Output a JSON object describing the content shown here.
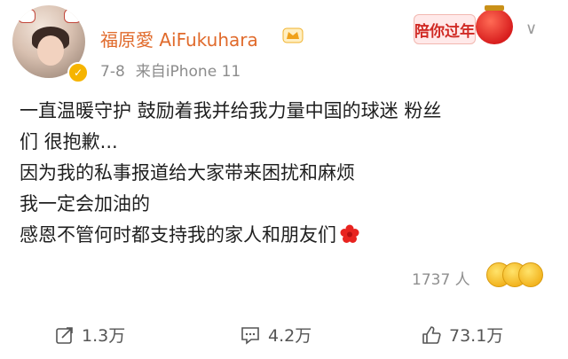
{
  "header": {
    "username": "福原愛 AiFukuhara",
    "date": "7-8",
    "source": "来自iPhone 11",
    "badge": "陪你过年"
  },
  "post": {
    "lines": [
      "一直温暖守护 鼓励着我并给我力量中国的球迷 粉丝",
      "们 很抱歉...",
      "因为我的私事报道给大家带来困扰和麻烦",
      "我一定会加油的",
      "感恩不管何时都支持我的家人和朋友们"
    ]
  },
  "reactions": {
    "count": "1737 人"
  },
  "actions": {
    "repost": "1.3万",
    "comment": "4.2万",
    "like": "73.1万"
  },
  "colors": {
    "username": "#e06a2b",
    "verified": "#f6b400",
    "badge": "#d02a24"
  },
  "icons": [
    "verified-icon",
    "vip-crown-icon",
    "red-flower-icon",
    "emoji-reaction-icons",
    "share-icon",
    "comment-icon",
    "like-icon",
    "chevron-down-icon"
  ]
}
